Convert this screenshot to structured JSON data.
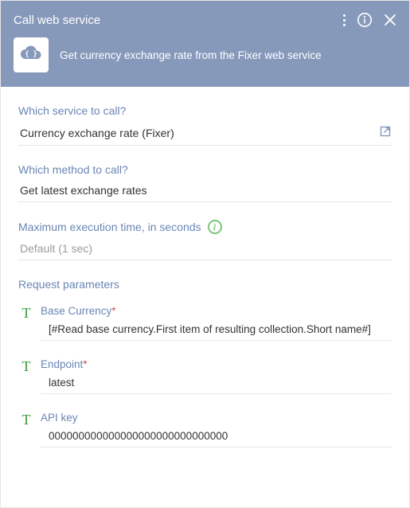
{
  "header": {
    "title": "Call web service",
    "subtitle": "Get currency exchange rate from the Fixer web service",
    "icon": "cloud-code-icon"
  },
  "fields": {
    "service": {
      "label": "Which service to call?",
      "value": "Currency exchange rate (Fixer)"
    },
    "method": {
      "label": "Which method to call?",
      "value": "Get latest exchange rates"
    },
    "timeout": {
      "label": "Maximum execution time, in seconds",
      "value": "Default (1 sec)"
    }
  },
  "request_params": {
    "title": "Request parameters",
    "items": [
      {
        "type_icon": "T",
        "label": "Base Currency",
        "required": true,
        "value": "[#Read base currency.First item of resulting collection.Short name#]"
      },
      {
        "type_icon": "T",
        "label": "Endpoint",
        "required": true,
        "value": "latest"
      },
      {
        "type_icon": "T",
        "label": "API key",
        "required": false,
        "value": "000000000000000000000000000000"
      }
    ]
  },
  "required_marker": "*",
  "colors": {
    "header_bg": "#8799bb",
    "accent_text": "#6a86b4",
    "param_type_icon": "#3a9a3a",
    "info_icon": "#7bc67b"
  }
}
